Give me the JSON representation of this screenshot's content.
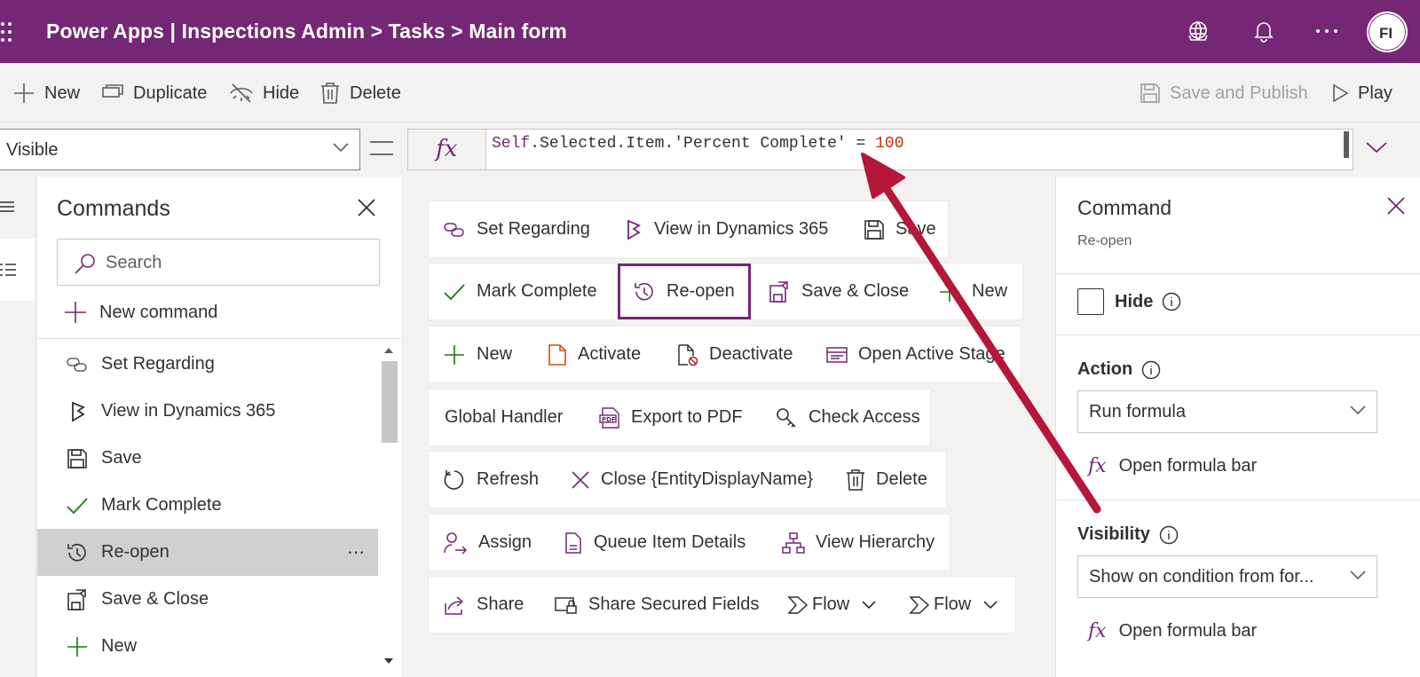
{
  "header": {
    "title": "Power Apps  |  Inspections Admin > Tasks > Main form",
    "avatar": "FI"
  },
  "toolbar": {
    "new": "New",
    "duplicate": "Duplicate",
    "hide": "Hide",
    "delete": "Delete",
    "save_publish": "Save and Publish",
    "play": "Play"
  },
  "formula_bar": {
    "property": "Visible",
    "fx": "fx",
    "tokens": {
      "self": "Self",
      ".dot": ".Selected.Item.'Percent Complete' = ",
      "num": "100"
    }
  },
  "commands_panel": {
    "title": "Commands",
    "search_placeholder": "Search",
    "new_command": "New command",
    "items": [
      {
        "label": "Set Regarding",
        "icon": "link-icon"
      },
      {
        "label": "View in Dynamics 365",
        "icon": "dynamics-icon"
      },
      {
        "label": "Save",
        "icon": "save-icon"
      },
      {
        "label": "Mark Complete",
        "icon": "checkmark-icon"
      },
      {
        "label": "Re-open",
        "icon": "history-icon",
        "selected": true
      },
      {
        "label": "Save & Close",
        "icon": "save-close-icon"
      },
      {
        "label": "New",
        "icon": "plus-icon"
      }
    ],
    "more": "⋯"
  },
  "canvas": {
    "rows": [
      [
        "Set Regarding",
        "View in Dynamics 365",
        "Save"
      ],
      [
        "Mark Complete",
        "Re-open",
        "Save & Close",
        "New"
      ],
      [
        "New",
        "Activate",
        "Deactivate",
        "Open Active Stage"
      ],
      [
        "Global Handler",
        "Export to PDF",
        "Check Access"
      ],
      [
        "Refresh",
        "Close {EntityDisplayName}",
        "Delete"
      ],
      [
        "Assign",
        "Queue Item Details",
        "View Hierarchy"
      ],
      [
        "Share",
        "Share Secured Fields",
        "Flow",
        "Flow"
      ]
    ]
  },
  "properties": {
    "title": "Command",
    "subtitle": "Re-open",
    "hide_label": "Hide",
    "action_label": "Action",
    "action_value": "Run formula",
    "open_formula": "Open formula bar",
    "visibility_label": "Visibility",
    "visibility_value": "Show on condition from for...",
    "open_formula2": "Open formula bar"
  },
  "colors": {
    "brand": "#742774",
    "annotation_arrow": "#b5163a",
    "accent_green": "#107c10"
  }
}
